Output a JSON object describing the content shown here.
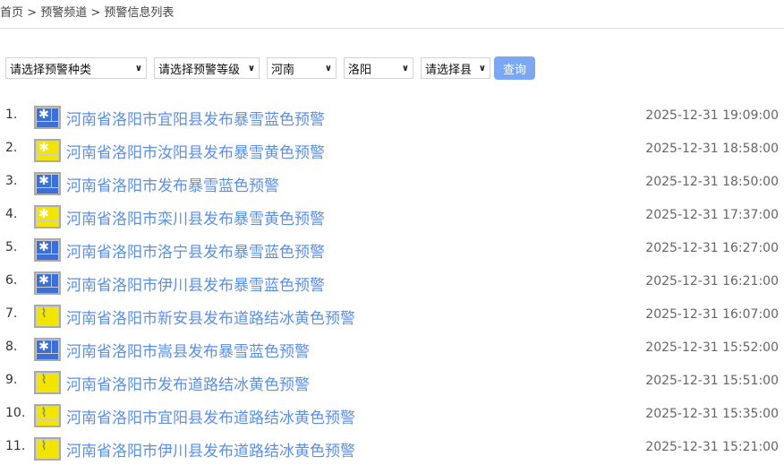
{
  "breadcrumb": [
    "首页",
    "预警频道",
    "预警信息列表"
  ],
  "separator": ">",
  "filters": {
    "type": "请选择预警种类",
    "level": "请选择预警等级",
    "province": "河南",
    "city": "洛阳",
    "county": "请选择县",
    "query": "查询"
  },
  "colors": {
    "blue": "#3d6fd8",
    "yellow": "#f2e600",
    "link": "#5b8fe6"
  },
  "items": [
    {
      "n": "1.",
      "title": "河南省洛阳市宜阳县发布暴雪蓝色预警",
      "time": "2025-12-31 19:09:00",
      "icon": "snow-blue"
    },
    {
      "n": "2.",
      "title": "河南省洛阳市汝阳县发布暴雪黄色预警",
      "time": "2025-12-31 18:58:00",
      "icon": "snow-yellow"
    },
    {
      "n": "3.",
      "title": "河南省洛阳市发布暴雪蓝色预警",
      "time": "2025-12-31 18:50:00",
      "icon": "snow-blue"
    },
    {
      "n": "4.",
      "title": "河南省洛阳市栾川县发布暴雪黄色预警",
      "time": "2025-12-31 17:37:00",
      "icon": "snow-yellow"
    },
    {
      "n": "5.",
      "title": "河南省洛阳市洛宁县发布暴雪蓝色预警",
      "time": "2025-12-31 16:27:00",
      "icon": "snow-blue"
    },
    {
      "n": "6.",
      "title": "河南省洛阳市伊川县发布暴雪蓝色预警",
      "time": "2025-12-31 16:21:00",
      "icon": "snow-blue"
    },
    {
      "n": "7.",
      "title": "河南省洛阳市新安县发布道路结冰黄色预警",
      "time": "2025-12-31 16:07:00",
      "icon": "road-ice-yellow"
    },
    {
      "n": "8.",
      "title": "河南省洛阳市嵩县发布暴雪蓝色预警",
      "time": "2025-12-31 15:52:00",
      "icon": "snow-blue"
    },
    {
      "n": "9.",
      "title": "河南省洛阳市发布道路结冰黄色预警",
      "time": "2025-12-31 15:51:00",
      "icon": "road-ice-yellow"
    },
    {
      "n": "10.",
      "title": "河南省洛阳市宜阳县发布道路结冰黄色预警",
      "time": "2025-12-31 15:35:00",
      "icon": "road-ice-yellow"
    },
    {
      "n": "11.",
      "title": "河南省洛阳市伊川县发布道路结冰黄色预警",
      "time": "2025-12-31 15:21:00",
      "icon": "road-ice-yellow"
    }
  ]
}
